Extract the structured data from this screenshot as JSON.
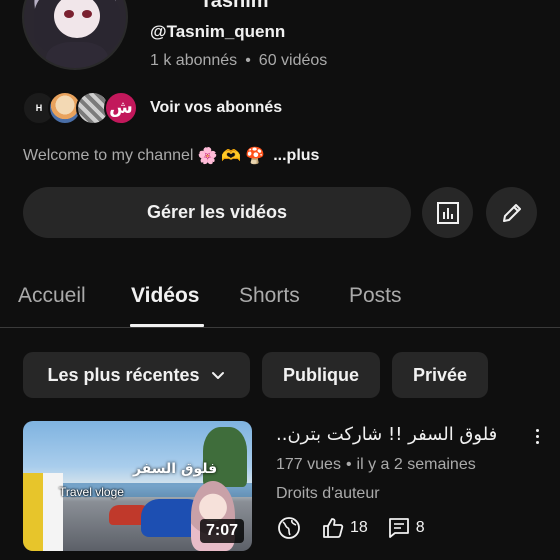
{
  "channel": {
    "name_partial": "Tasnim",
    "handle": "@Tasnim_quenn",
    "subscribers": "1 k abonnés",
    "videos_count": "60 vidéos",
    "separator": "•",
    "subscribers_link": "Voir vos abonnés",
    "subscriber_initials": [
      "H",
      "",
      "",
      "ش"
    ],
    "description": "Welcome to my channel",
    "description_emojis": [
      "🌸",
      "🫶",
      "🍄"
    ],
    "description_more": "...plus"
  },
  "actions": {
    "manage_videos": "Gérer les vidéos",
    "analytics_icon": "analytics-icon",
    "edit_icon": "pencil-icon"
  },
  "tabs": [
    "Accueil",
    "Vidéos",
    "Shorts",
    "Posts"
  ],
  "active_tab": "Vidéos",
  "filters": {
    "sort": "Les plus récentes",
    "public": "Publique",
    "private": "Privée"
  },
  "video": {
    "title": "فلوق السفر !! شاركت بترن..",
    "views": "177 vues",
    "time": "il y a 2 semaines",
    "rights": "Droits d'auteur",
    "duration": "7:07",
    "likes": "18",
    "comments": "8",
    "thumb_text_travel": "Travel vloge",
    "thumb_text_ar": "فلوق السفر"
  },
  "colors": {
    "background": "#0f0f0f",
    "chip": "#272727",
    "secondary_text": "#aaaaaa",
    "primary_text": "#f1f1f1"
  }
}
